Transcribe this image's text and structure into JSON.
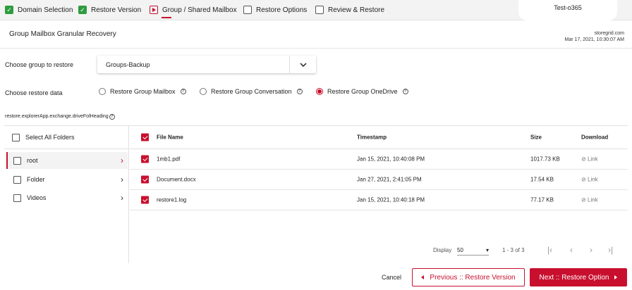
{
  "wizard": {
    "steps": [
      {
        "label": "Domain Selection",
        "state": "done"
      },
      {
        "label": "Restore Version",
        "state": "done"
      },
      {
        "label": "Group / Shared Mailbox",
        "state": "current"
      },
      {
        "label": "Restore Options",
        "state": "todo"
      },
      {
        "label": "Review & Restore",
        "state": "todo"
      }
    ],
    "tenant": "Test-o365"
  },
  "header": {
    "title": "Group Mailbox Granular Recovery",
    "account": "storegrid.com",
    "timestamp": "Mar 17, 2021, 10:30:07 AM"
  },
  "form": {
    "group_label": "Choose group to restore",
    "group_value": "Groups-Backup",
    "data_label": "Choose restore data",
    "options": [
      {
        "label": "Restore Group Mailbox",
        "selected": false
      },
      {
        "label": "Restore Group Conversation",
        "selected": false
      },
      {
        "label": "Restore Group OneDrive",
        "selected": true
      }
    ],
    "help_glyph": "?"
  },
  "drive_heading": "restore.explorerApp.exchange.driveFolHeading",
  "tree": {
    "select_all": "Select All Folders",
    "folders": [
      {
        "name": "root",
        "selected": true
      },
      {
        "name": "Folder",
        "selected": false
      },
      {
        "name": "Videos",
        "selected": false
      }
    ]
  },
  "files": {
    "columns": [
      "File Name",
      "Timestamp",
      "Size",
      "Download"
    ],
    "rows": [
      {
        "name": "1mb1.pdf",
        "timestamp": "Jan 15, 2021, 10:40:08 PM",
        "size": "1017.73 KB",
        "download": "Link"
      },
      {
        "name": "Document.docx",
        "timestamp": "Jan 27, 2021, 2:41:05 PM",
        "size": "17.54 KB",
        "download": "Link"
      },
      {
        "name": "restore1.log",
        "timestamp": "Jan 15, 2021, 10:40:18 PM",
        "size": "77.17 KB",
        "download": "Link"
      }
    ]
  },
  "pager": {
    "display_label": "Display",
    "page_size": "50",
    "range": "1 - 3 of 3"
  },
  "footer": {
    "cancel": "Cancel",
    "prev": "Previous :: Restore Version",
    "next": "Next :: Restore Option"
  },
  "colors": {
    "accent": "#c8102e",
    "done": "#2e9b3f"
  }
}
